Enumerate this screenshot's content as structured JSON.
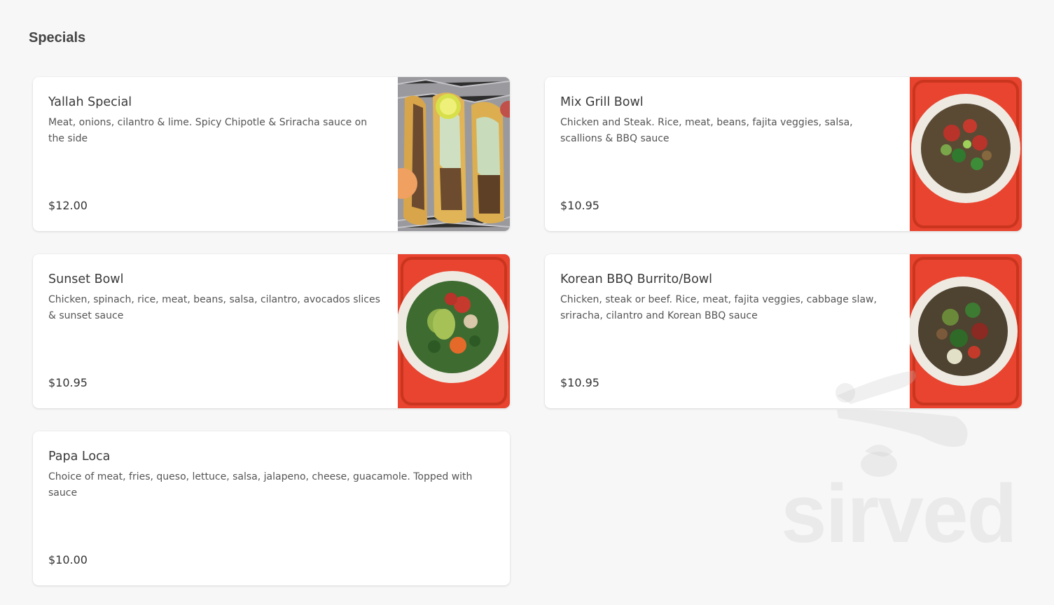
{
  "section": {
    "title": "Specials"
  },
  "items": [
    {
      "name": "Yallah Special",
      "description": "Meat, onions, cilantro & lime. Spicy Chipotle & Sriracha sauce on the side",
      "price": "$12.00",
      "photo": "tacos-photo"
    },
    {
      "name": "Mix Grill Bowl",
      "description": "Chicken and Steak. Rice, meat, beans, fajita veggies, salsa, scallions & BBQ sauce",
      "price": "$10.95",
      "photo": "mix-grill-bowl-photo"
    },
    {
      "name": "Sunset Bowl",
      "description": "Chicken, spinach, rice, meat, beans, salsa, cilantro, avocados slices & sunset sauce",
      "price": "$10.95",
      "photo": "sunset-bowl-photo"
    },
    {
      "name": "Korean BBQ Burrito/Bowl",
      "description": "Chicken, steak or beef. Rice, meat, fajita veggies, cabbage slaw, sriracha, cilantro and Korean BBQ sauce",
      "price": "$10.95",
      "photo": "korean-bbq-bowl-photo"
    },
    {
      "name": "Papa Loca",
      "description": "Choice of meat, fries, queso, lettuce, salsa, jalapeno, cheese, guacamole. Topped with sauce",
      "price": "$10.00"
    }
  ],
  "watermark": {
    "text": "sirved",
    "icon": "sirved-logo-icon"
  },
  "colors": {
    "background": "#f7f7f7",
    "card": "#ffffff",
    "tray_red": "#e8442f",
    "title": "#444444"
  }
}
